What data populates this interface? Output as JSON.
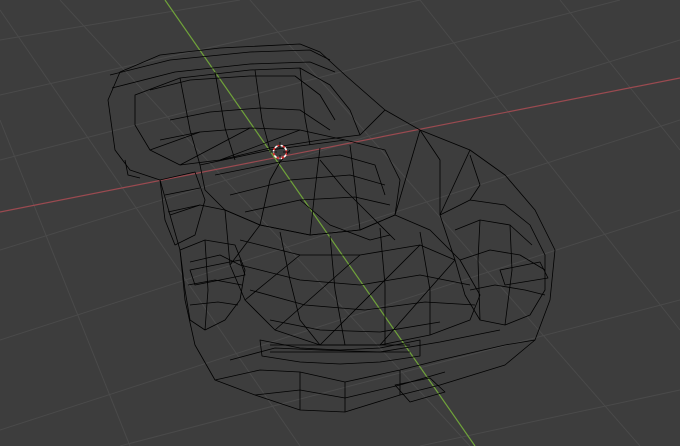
{
  "app": "3D viewport",
  "view": {
    "mode": "wireframe",
    "background_color": "#3d3d3d",
    "grid_color": "#4a4a4a",
    "x_axis_color": "#9a4a50",
    "y_axis_color": "#6fa23a",
    "wire_color": "#000000"
  },
  "scene": {
    "object": "car-mesh",
    "cursor": "3d-cursor-icon"
  }
}
